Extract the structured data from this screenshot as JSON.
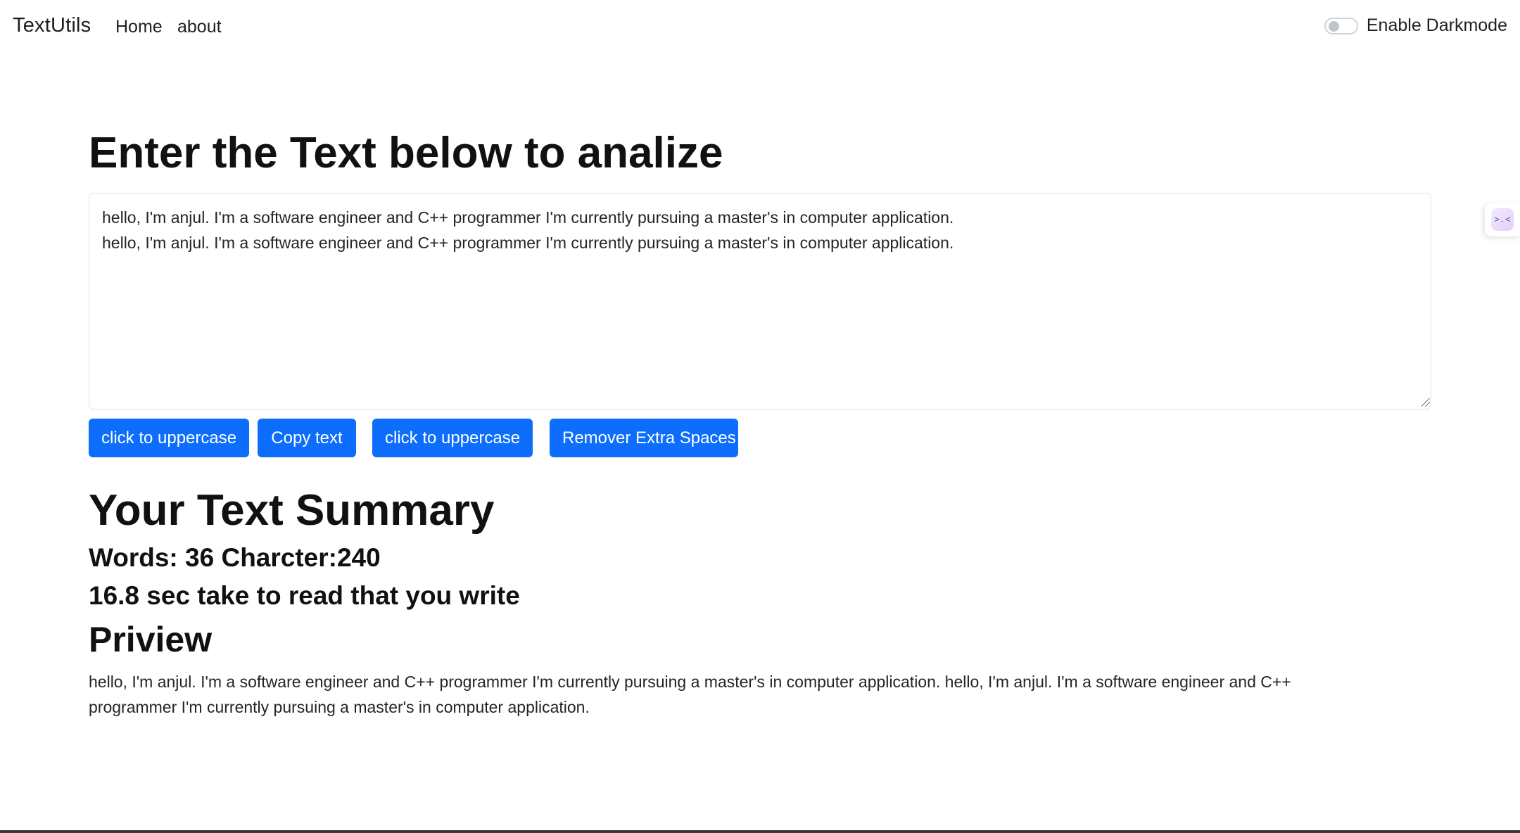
{
  "navbar": {
    "brand": "TextUtils",
    "links": [
      "Home",
      "about"
    ],
    "darkmode_label": "Enable Darkmode",
    "darkmode_on": false
  },
  "main": {
    "title": "Enter the Text below to analize",
    "textarea_value": "hello, I'm anjul. I'm a software engineer and C++ programmer I'm currently pursuing a master's in computer application.\nhello, I'm anjul. I'm a software engineer and C++ programmer I'm currently pursuing a master's in computer application.",
    "buttons": [
      "click to uppercase",
      "Copy text",
      "click to uppercase",
      "Remover Extra Spaces"
    ]
  },
  "summary": {
    "title": "Your Text Summary",
    "stats": "Words: 36 Charcter:240",
    "read_time": "16.8 sec take to read that you write",
    "preview_title": "Priview",
    "preview_text": "hello, I'm anjul. I'm a software engineer and C++ programmer I'm currently pursuing a master's in computer application. hello, I'm anjul. I'm a software engineer and C++ programmer I'm currently pursuing a master's in computer application."
  },
  "side_widget": {
    "icon": "assistant-face-icon",
    "glyph": ">.<"
  },
  "colors": {
    "primary_button": "#0d6efd",
    "text": "#212529"
  }
}
